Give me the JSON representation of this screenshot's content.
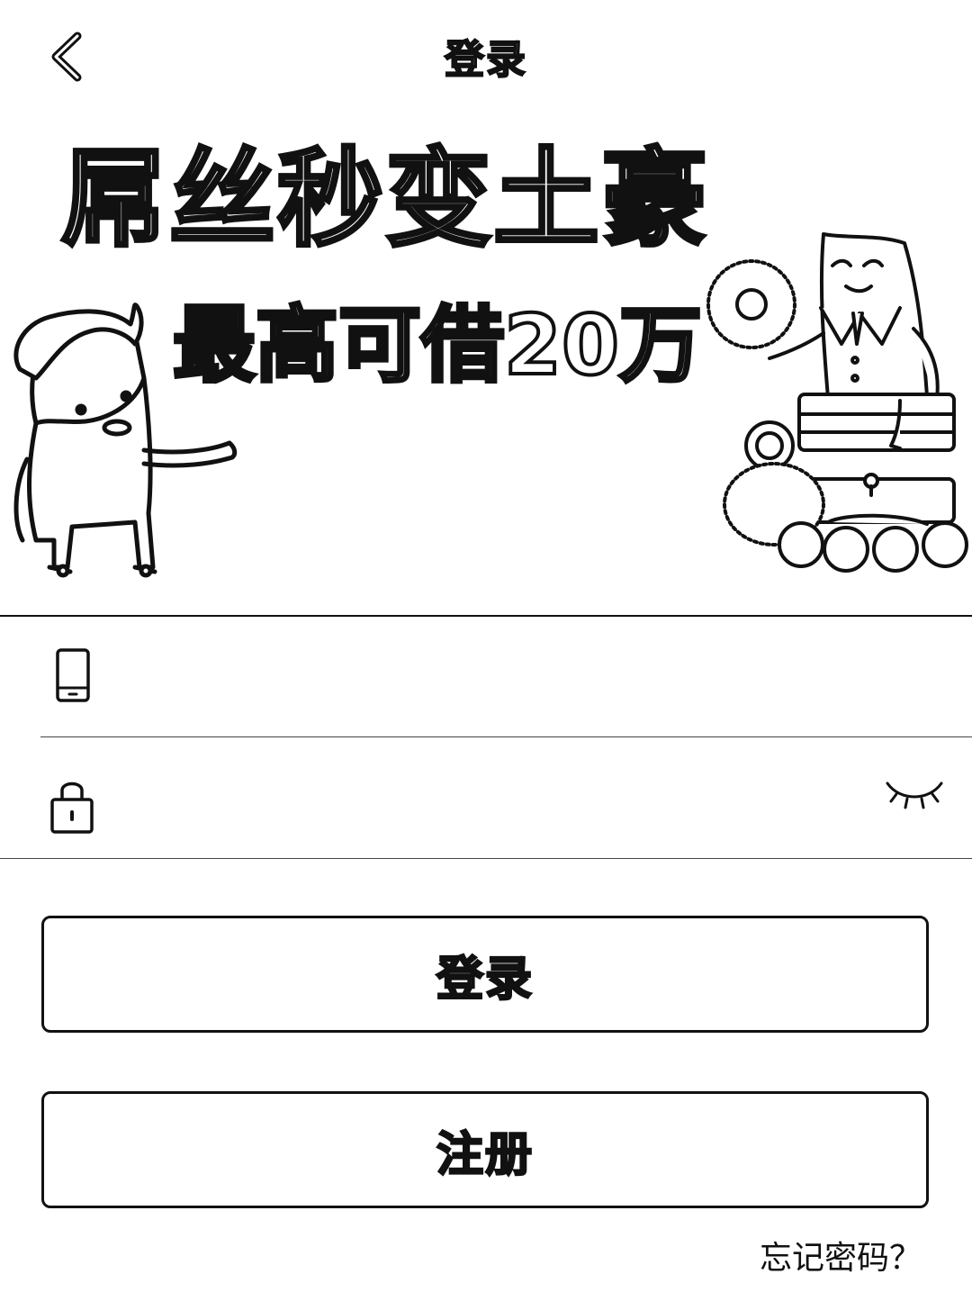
{
  "header": {
    "title": "登录",
    "back_icon": "chevron-left-icon"
  },
  "banner": {
    "headline": "屌丝秒变土豪",
    "subline": "最高可借20万"
  },
  "form": {
    "phone": {
      "icon": "phone-icon",
      "value": "",
      "placeholder": ""
    },
    "password": {
      "icon": "lock-icon",
      "value": "",
      "placeholder": "",
      "toggle_icon": "eye-closed-icon"
    }
  },
  "actions": {
    "login_label": "登录",
    "register_label": "注册",
    "forgot_label": "忘记密码？"
  },
  "colors": {
    "ink": "#111111",
    "background": "#ffffff"
  }
}
